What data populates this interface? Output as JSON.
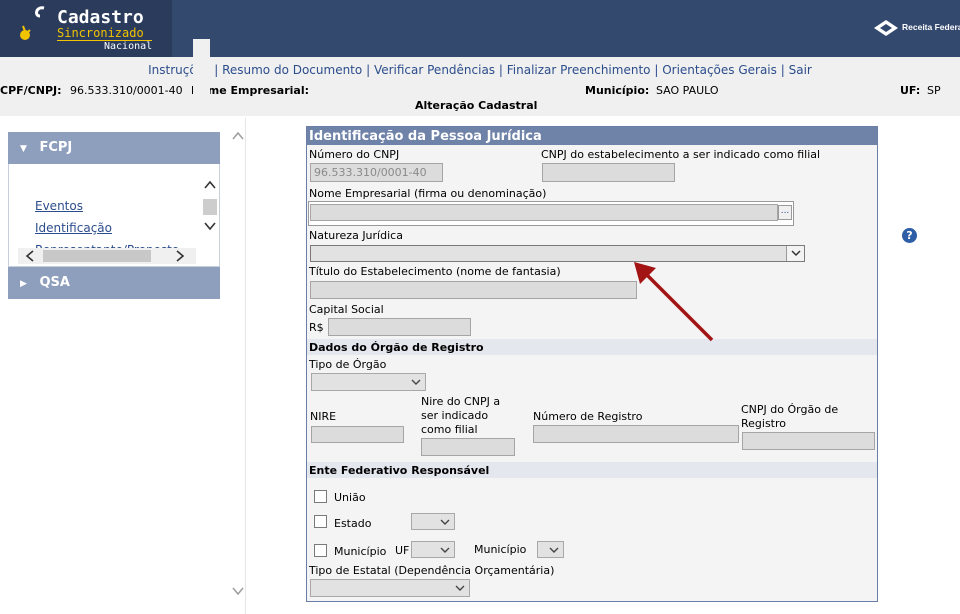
{
  "header": {
    "app_title": "Cadastro",
    "app_subtitle": "Sincronizado",
    "app_scope": "Nacional",
    "agency": "Receita Federal"
  },
  "nav": {
    "items": [
      "Instruções",
      "Resumo do Documento",
      "Verificar Pendências",
      "Finalizar Preenchimento",
      "Orientações Gerais",
      "Sair"
    ],
    "separator": "|"
  },
  "infobar": {
    "cnpj_label": "CPF/CNPJ:",
    "cnpj_value": "96.533.310/0001-40",
    "name_label": "Nome Empresarial:",
    "municipio_label": "Município:",
    "municipio_value": "SAO PAULO",
    "uf_label": "UF:",
    "uf_value": "SP",
    "operation": "Alteração Cadastral"
  },
  "sidebar": {
    "fcpj_label": "FCPJ",
    "items": [
      "Eventos",
      "Identificação",
      "Representante/Preposto"
    ],
    "qsa_label": "QSA"
  },
  "form": {
    "title": "Identificação da Pessoa Jurídica",
    "cnpj_label": "Número do CNPJ",
    "cnpj_value": "96.533.310/0001-40",
    "filial_cnpj_label": "CNPJ do estabelecimento a ser indicado como filial",
    "filial_cnpj_value": "",
    "nome_label": "Nome Empresarial (firma ou denominação)",
    "nome_value": "",
    "lookup_button": "...",
    "natureza_label": "Natureza Jurídica",
    "natureza_value": "",
    "titulo_label": "Título do Estabelecimento (nome de fantasia)",
    "titulo_value": "",
    "capital_label": "Capital Social",
    "currency": "R$",
    "capital_value": "",
    "registro_section": "Dados do Órgão de Registro",
    "tipo_orgao_label": "Tipo de Órgão",
    "nire_label": "NIRE",
    "nire_filial_label_1": "Nire do CNPJ a",
    "nire_filial_label_2": "ser indicado",
    "nire_filial_label_3": "como filial",
    "numero_registro_label": "Número de Registro",
    "cnpj_orgao_label_1": "CNPJ do Órgão de",
    "cnpj_orgao_label_2": "Registro",
    "ente_section": "Ente Federativo Responsável",
    "uniao_label": "União",
    "estado_label": "Estado",
    "municipio_label": "Município",
    "uf_label": "UF",
    "municipio_select_label": "Município",
    "tipo_estatal_label": "Tipo de Estatal (Dependência Orçamentária)"
  },
  "colors": {
    "header_bg": "#34496e",
    "accent_yellow": "#f2c300",
    "link_blue": "#2c4d8c",
    "annotation_arrow": "#a31515"
  },
  "help_icon": "?"
}
